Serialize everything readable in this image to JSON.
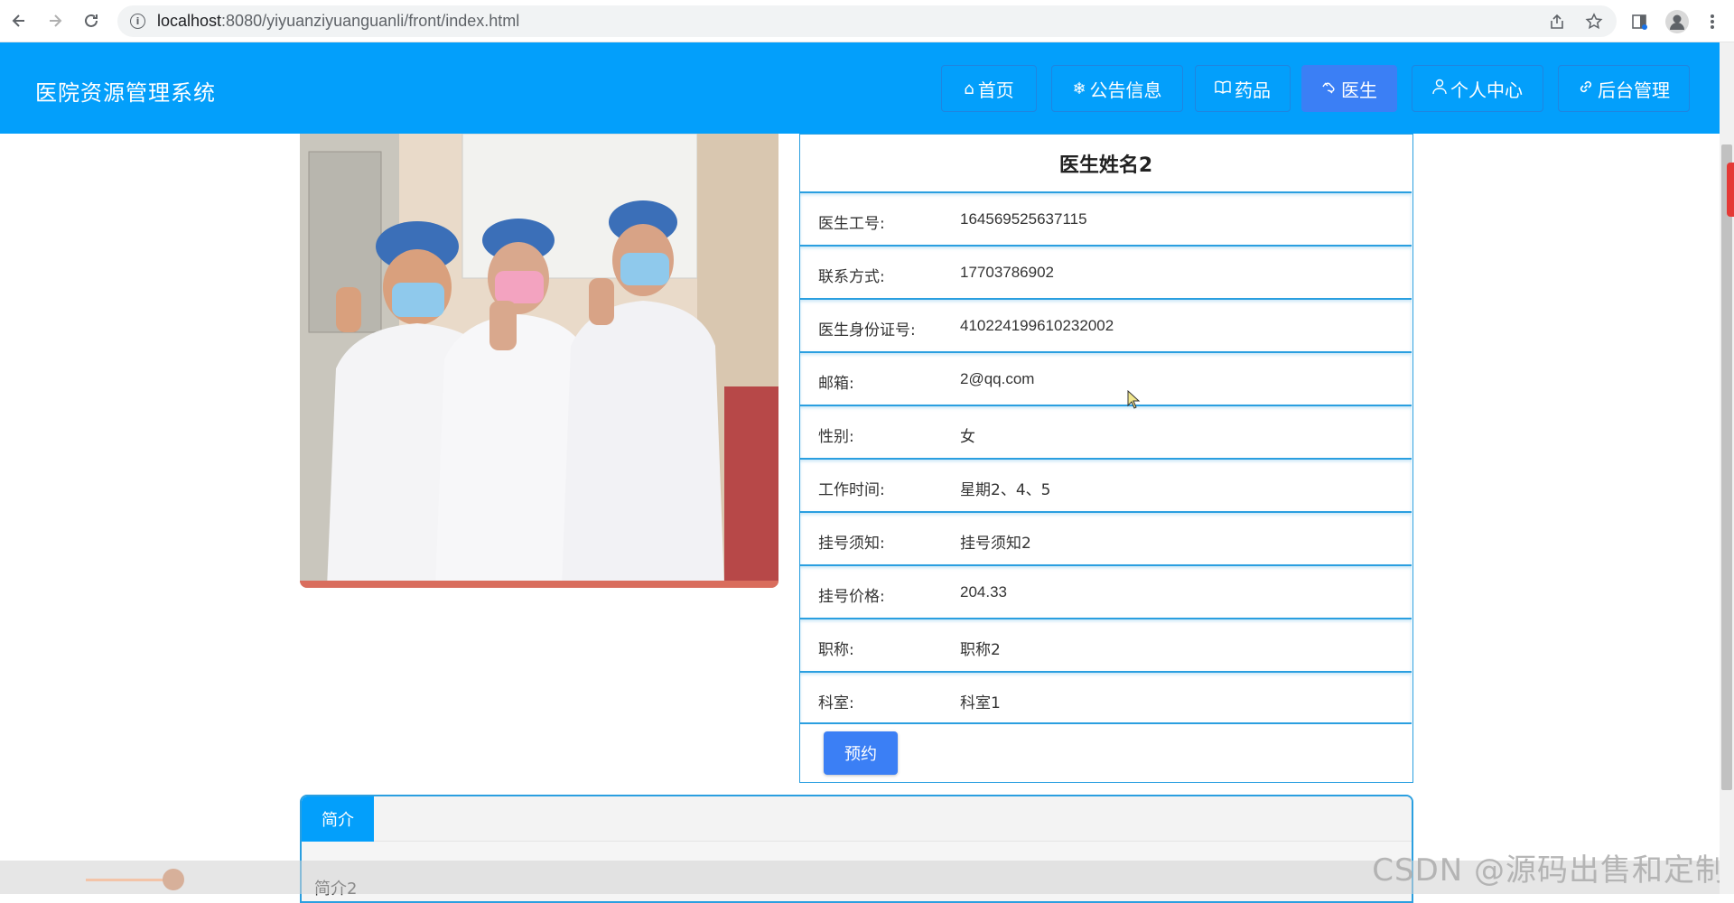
{
  "browser": {
    "url_host": "localhost",
    "url_path": ":8080/yiyuanziyuanguanli/front/index.html",
    "back_icon": "arrow-left",
    "forward_icon": "arrow-right",
    "reload_icon": "reload"
  },
  "header": {
    "title": "医院资源管理系统",
    "nav": [
      {
        "label": "首页",
        "icon": "home-icon",
        "glyph": "⌂"
      },
      {
        "label": "公告信息",
        "icon": "snowflake-icon",
        "glyph": "❄"
      },
      {
        "label": "药品",
        "icon": "book-icon",
        "glyph": "📖"
      },
      {
        "label": "医生",
        "icon": "doctor-icon",
        "glyph": "⚕",
        "active": true
      },
      {
        "label": "个人中心",
        "icon": "user-icon",
        "glyph": "👤"
      },
      {
        "label": "后台管理",
        "icon": "link-icon",
        "glyph": "🔗"
      }
    ]
  },
  "doctor": {
    "name": "医生姓名2",
    "fields": [
      {
        "label": "医生工号:",
        "value": "164569525637115"
      },
      {
        "label": "联系方式:",
        "value": "17703786902"
      },
      {
        "label": "医生身份证号:",
        "value": "410224199610232002"
      },
      {
        "label": "邮箱:",
        "value": "2@qq.com"
      },
      {
        "label": "性别:",
        "value": "女"
      },
      {
        "label": "工作时间:",
        "value": "星期2、4、5"
      },
      {
        "label": "挂号须知:",
        "value": "挂号须知2"
      },
      {
        "label": "挂号价格:",
        "value": "204.33"
      },
      {
        "label": "职称:",
        "value": "职称2"
      },
      {
        "label": "科室:",
        "value": "科室1"
      }
    ],
    "book_button": "预约"
  },
  "tabs": {
    "active_label": "简介",
    "content": "简介2"
  },
  "watermark": "CSDN @源码出售和定制",
  "colors": {
    "header_bg": "#039ffb",
    "active_nav": "#3b7ff5",
    "border": "#2a9fe0"
  }
}
